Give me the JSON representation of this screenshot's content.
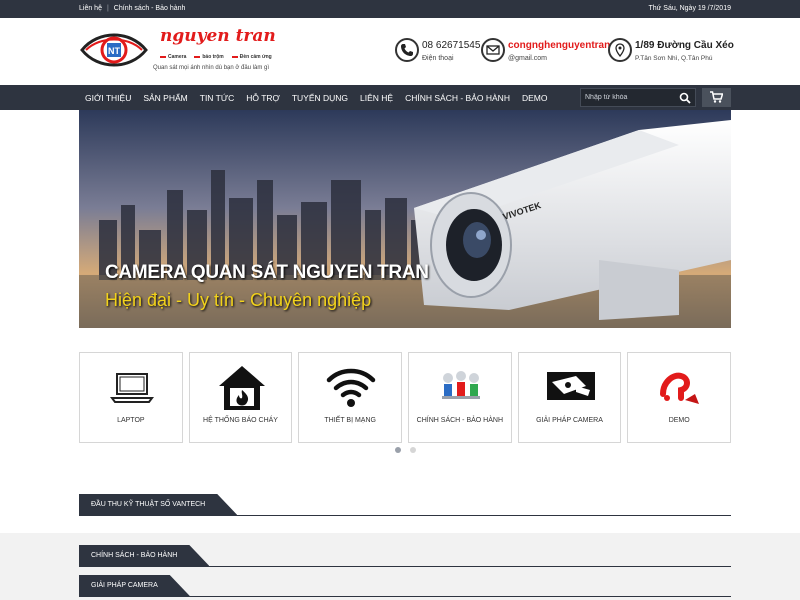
{
  "topbar": {
    "links": [
      "Liên hệ",
      "Chính sách - Bảo hành"
    ],
    "date": "Thứ Sáu, Ngày 19 /7/2019"
  },
  "brand": {
    "name": "nguyen tran",
    "tags": [
      "Camera",
      "báo trộm",
      "Đèn cảm ứng"
    ],
    "slogan": "Quan sát mọi ánh nhìn dù bạn ở đâu làm gì"
  },
  "contacts": {
    "phone": {
      "line1": "08 62671545",
      "line2": "Điện thoại",
      "icon": "phone-icon"
    },
    "email": {
      "line1": "congnghenguyentran",
      "line2": "@gmail.com",
      "icon": "mail-icon"
    },
    "address": {
      "line1": "1/89 Đường Cầu Xéo",
      "line2": "P.Tân Sơn Nhì, Q.Tân Phú",
      "icon": "map-pin-icon"
    }
  },
  "nav": {
    "items": [
      "GIỚI THIỆU",
      "SẢN PHẨM",
      "TIN TỨC",
      "HỖ TRỢ",
      "TUYỂN DỤNG",
      "LIÊN HỆ",
      "CHÍNH SÁCH - BẢO HÀNH",
      "DEMO"
    ],
    "search_placeholder": "Nhập từ khóa"
  },
  "banner": {
    "title": "CAMERA QUAN SÁT NGUYEN TRAN",
    "subtitle": "Hiện đại - Uy tín - Chuyên nghiệp",
    "camera_brand": "VIVOTEK"
  },
  "categories": [
    {
      "label": "LAPTOP",
      "icon": "laptop-icon"
    },
    {
      "label": "HỆ THỐNG BÁO CHÁY",
      "icon": "fire-alarm-icon"
    },
    {
      "label": "THIẾT BỊ MẠNG",
      "icon": "wifi-icon"
    },
    {
      "label": "CHÍNH SÁCH - BẢO HÀNH",
      "icon": "people-icon"
    },
    {
      "label": "GIẢI PHÁP CAMERA",
      "icon": "camera-icon"
    },
    {
      "label": "DEMO",
      "icon": "demo-icon"
    }
  ],
  "sections": [
    "ĐẦU THU KỸ THUẬT SỐ VANTECH",
    "CHÍNH SÁCH - BẢO HÀNH",
    "GIẢI PHÁP CAMERA"
  ],
  "colors": {
    "dark": "#2e3440",
    "accent_red": "#e21b1b",
    "banner_yellow": "#f2d21b"
  }
}
